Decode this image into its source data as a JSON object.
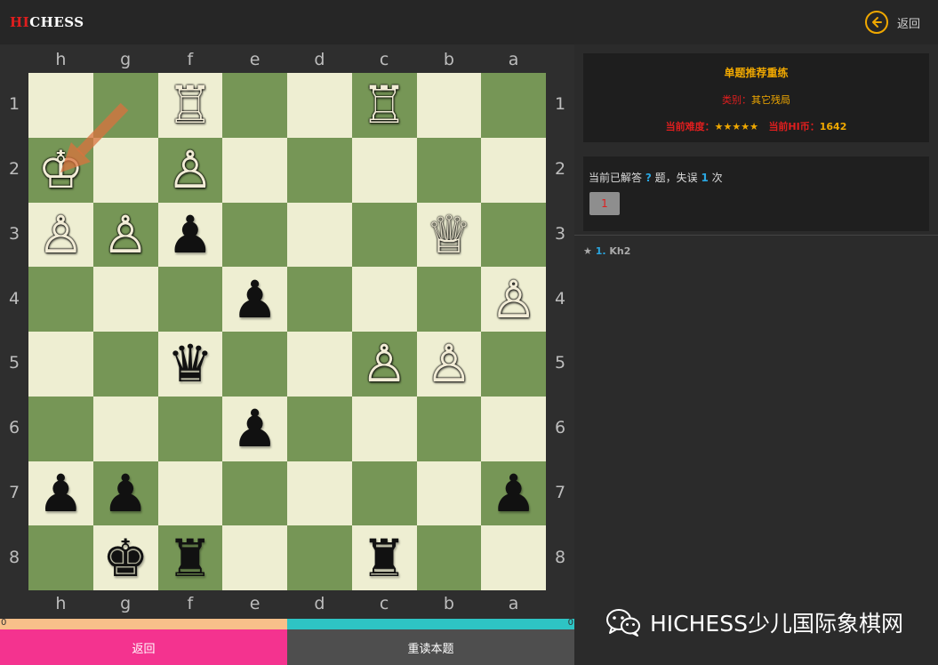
{
  "header": {
    "logo_hi": "HI",
    "logo_chess": "CHESS",
    "back_label": "返回"
  },
  "board": {
    "top_files": [
      "h",
      "g",
      "f",
      "e",
      "d",
      "c",
      "b",
      "a"
    ],
    "bottom_files": [
      "h",
      "g",
      "f",
      "e",
      "d",
      "c",
      "b",
      "a"
    ],
    "ranks": [
      "1",
      "2",
      "3",
      "4",
      "5",
      "6",
      "7",
      "8"
    ],
    "squares": [
      [
        "",
        "",
        "wR",
        "",
        "",
        "wR",
        "",
        ""
      ],
      [
        "wK",
        "",
        "wP",
        "",
        "",
        "",
        "",
        ""
      ],
      [
        "wP",
        "wP",
        "bP",
        "",
        "",
        "",
        "wQ",
        ""
      ],
      [
        "",
        "",
        "",
        "bP",
        "",
        "",
        "",
        "wP"
      ],
      [
        "",
        "",
        "bQ",
        "",
        "",
        "wP",
        "wP",
        ""
      ],
      [
        "",
        "",
        "",
        "bP",
        "",
        "",
        "",
        ""
      ],
      [
        "bP",
        "bP",
        "",
        "",
        "",
        "",
        "",
        "bP"
      ],
      [
        "",
        "bK",
        "bR",
        "",
        "",
        "bR",
        "",
        ""
      ]
    ],
    "piece_glyphs": {
      "wK": "♔",
      "wQ": "♕",
      "wR": "♖",
      "wB": "♗",
      "wN": "♘",
      "wP": "♙",
      "bK": "♚",
      "bQ": "♛",
      "bR": "♜",
      "bB": "♝",
      "bN": "♞",
      "bP": "♟"
    },
    "light_color": "#eeeed2",
    "dark_color": "#769656",
    "arrow_color": "#d9733e"
  },
  "score": {
    "left_value": "0",
    "right_value": "0",
    "left_color": "#f8c08a",
    "right_color": "#2ec4c4"
  },
  "buttons": {
    "back": "返回",
    "reread": "重读本题"
  },
  "panel": {
    "title": "单题推荐重练",
    "category_label": "类别：",
    "category_value": "其它残局",
    "difficulty_label": "当前难度：",
    "difficulty_stars": "★★★★★",
    "hi_label": "当前HI币：",
    "hi_value": "1642"
  },
  "progress": {
    "prefix": "当前已解答",
    "answered": "?",
    "middle": "题，失误",
    "mistakes": "1",
    "suffix": "次",
    "attempt_number": "1"
  },
  "moves": {
    "star": "★",
    "number": "1.",
    "move": "Kh2"
  },
  "watermark": {
    "text": "HICHESS少儿国际象棋网"
  }
}
